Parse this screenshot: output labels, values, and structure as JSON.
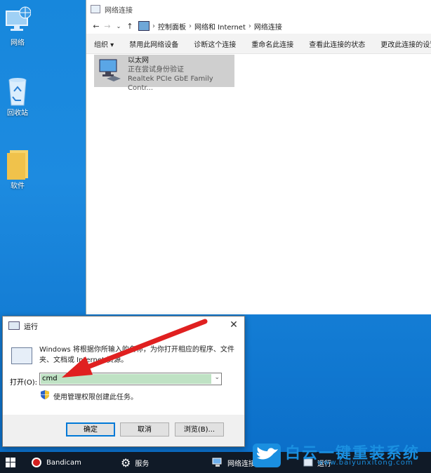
{
  "desktop": {
    "icons": [
      {
        "label": "网络",
        "icon": "network-computer-icon"
      },
      {
        "label": "回收站",
        "icon": "recycle-bin-icon"
      },
      {
        "label": "软件",
        "icon": "folder-icon"
      }
    ]
  },
  "explorer": {
    "title": "网络连接",
    "breadcrumb": [
      "控制面板",
      "网络和 Internet",
      "网络连接"
    ],
    "toolbar": [
      "组织 ▾",
      "禁用此网络设备",
      "诊断这个连接",
      "重命名此连接",
      "查看此连接的状态",
      "更改此连接的设置"
    ],
    "connection": {
      "name": "以太网",
      "status": "正在尝试身份验证",
      "adapter": "Realtek PCIe GbE Family Contr..."
    }
  },
  "run_dialog": {
    "title": "运行",
    "description": "Windows 将根据你所输入的名称，为你打开相应的程序、文件夹、文档或 Internet 资源。",
    "open_label": "打开(O):",
    "input_value": "cmd",
    "admin_note": "使用管理权限创建此任务。",
    "ok": "确定",
    "cancel": "取消",
    "browse": "浏览(B)..."
  },
  "taskbar": {
    "items": [
      {
        "label": "Bandicam",
        "icon": "record-icon"
      },
      {
        "label": "服务",
        "icon": "gear-icon"
      },
      {
        "label": "网络连接",
        "icon": "network-icon"
      },
      {
        "label": "运行",
        "icon": "run-icon"
      }
    ]
  },
  "watermark": {
    "title": "白云一键重装系统",
    "url": "www.baiyunxitong.com"
  },
  "colors": {
    "desktop": "#1787dc",
    "taskbar": "#101a27",
    "arrow": "#e02020",
    "selection": "#bfe2c4"
  }
}
